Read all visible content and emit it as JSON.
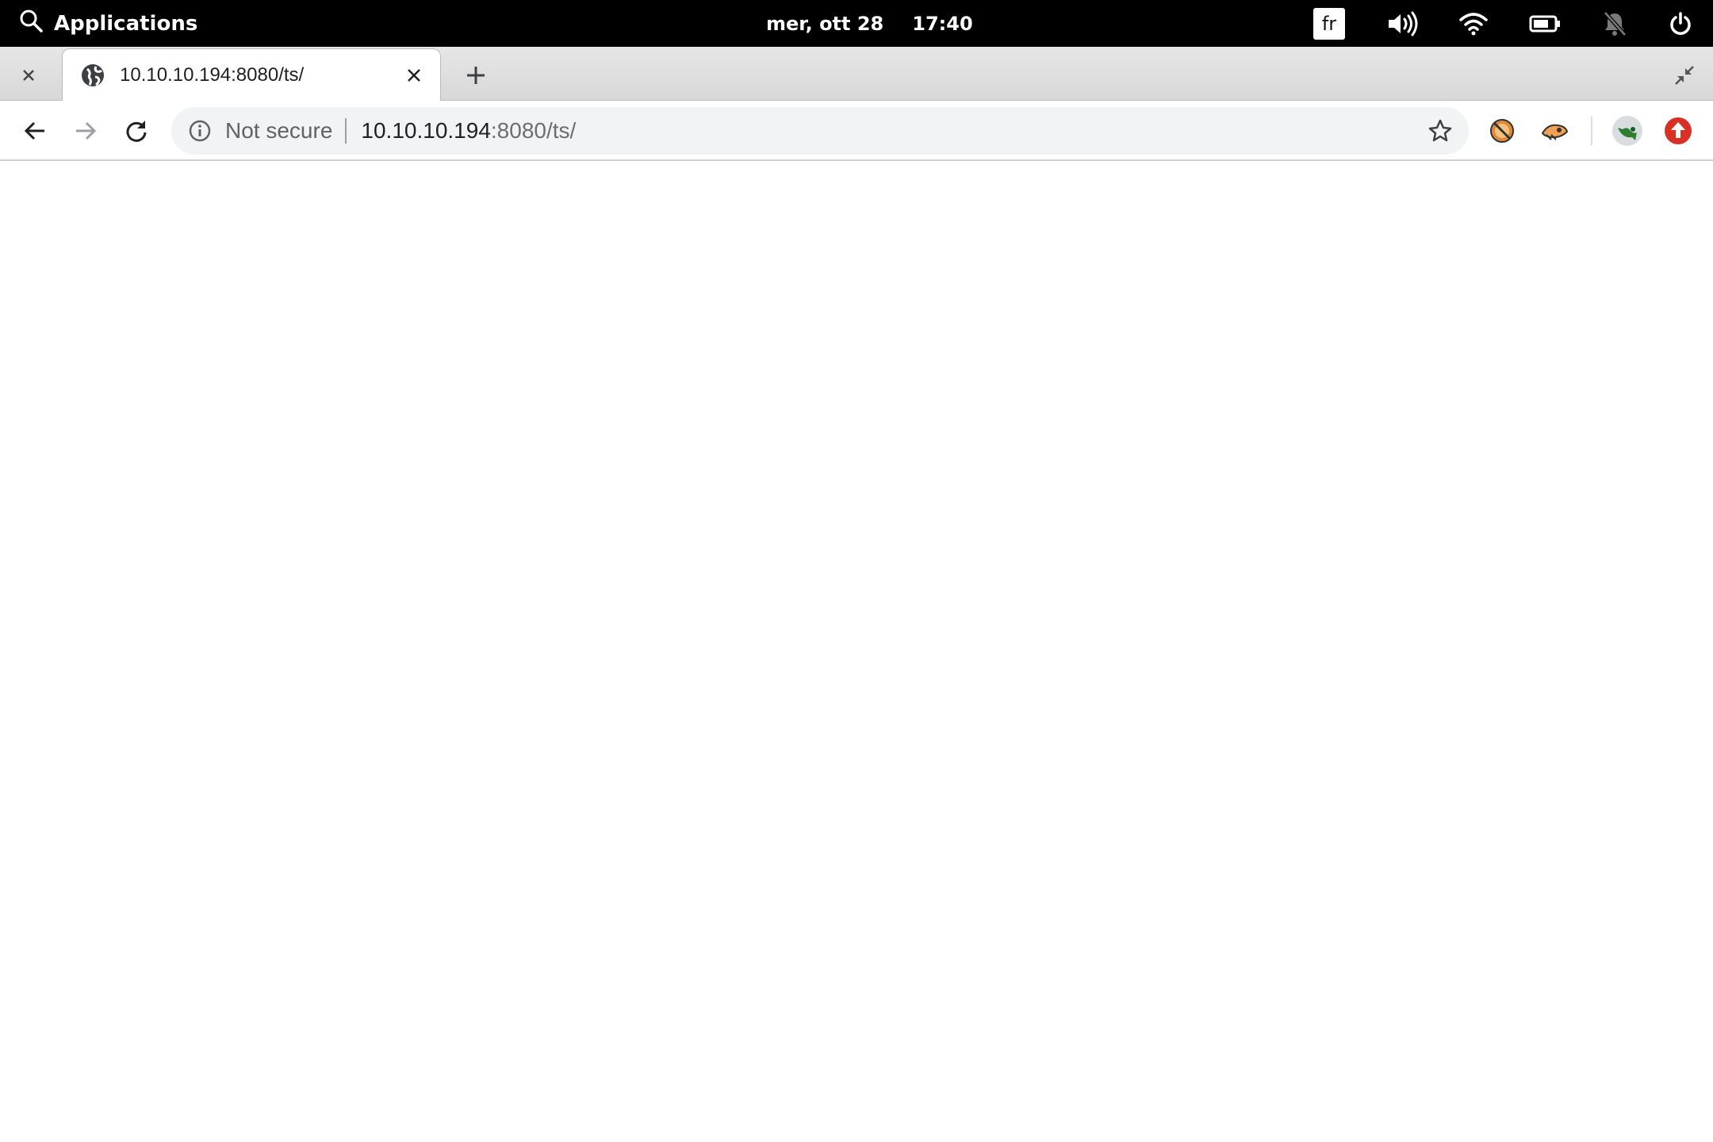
{
  "system_bar": {
    "applications_label": "Applications",
    "date": "mer, ott 28",
    "time": "17:40",
    "keyboard_layout": "fr",
    "tray_icons": [
      "volume-icon",
      "wifi-icon",
      "battery-icon",
      "notifications-off-icon",
      "power-icon"
    ]
  },
  "browser": {
    "tab": {
      "title": "10.10.10.194:8080/ts/",
      "favicon": "globe-icon"
    },
    "omnibox": {
      "security_label": "Not secure",
      "url_host": "10.10.10.194",
      "url_rest": ":8080/ts/"
    },
    "extensions": [
      "extension-1-icon",
      "extension-2-icon",
      "profile-avatar",
      "update-icon"
    ],
    "colors": {
      "update_badge": "#d93025",
      "omnibox_bg": "#f1f3f4"
    }
  }
}
